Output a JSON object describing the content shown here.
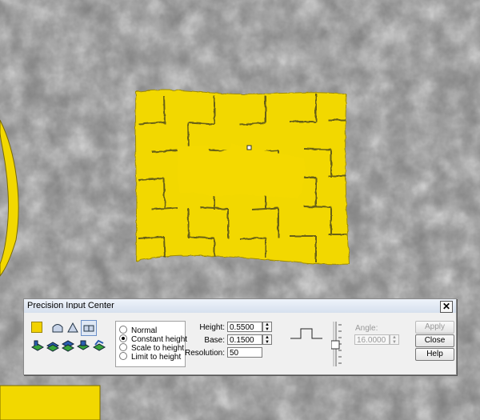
{
  "dialog": {
    "title": "Precision Input Center",
    "close_glyph": "✕",
    "mode_options": [
      {
        "label": "Normal",
        "selected": false
      },
      {
        "label": "Constant height",
        "selected": true
      },
      {
        "label": "Scale to height",
        "selected": false
      },
      {
        "label": "Limit to height",
        "selected": false
      }
    ],
    "height_label": "Height:",
    "height_value": "0.5500",
    "base_label": "Base:",
    "base_value": "0.1500",
    "resolution_label": "Resolution:",
    "resolution_value": "50",
    "angle_label": "Angle:",
    "angle_value": "16.0000",
    "buttons": {
      "apply": "Apply",
      "close": "Close",
      "help": "Help"
    },
    "swatch_color": "#f2d200",
    "tools_row1": [
      "color-swatch-icon",
      "dome-profile-icon",
      "pyramid-profile-icon",
      "flat-profile-icon"
    ],
    "tools_row2": [
      "layer-stack-icon-1",
      "layer-stack-icon-2",
      "layer-stack-icon-3",
      "layer-stack-icon-4",
      "layer-stack-icon-5"
    ]
  },
  "colors": {
    "relief_yellow": "#f2d800",
    "background_gray": "#7d7d7d"
  }
}
